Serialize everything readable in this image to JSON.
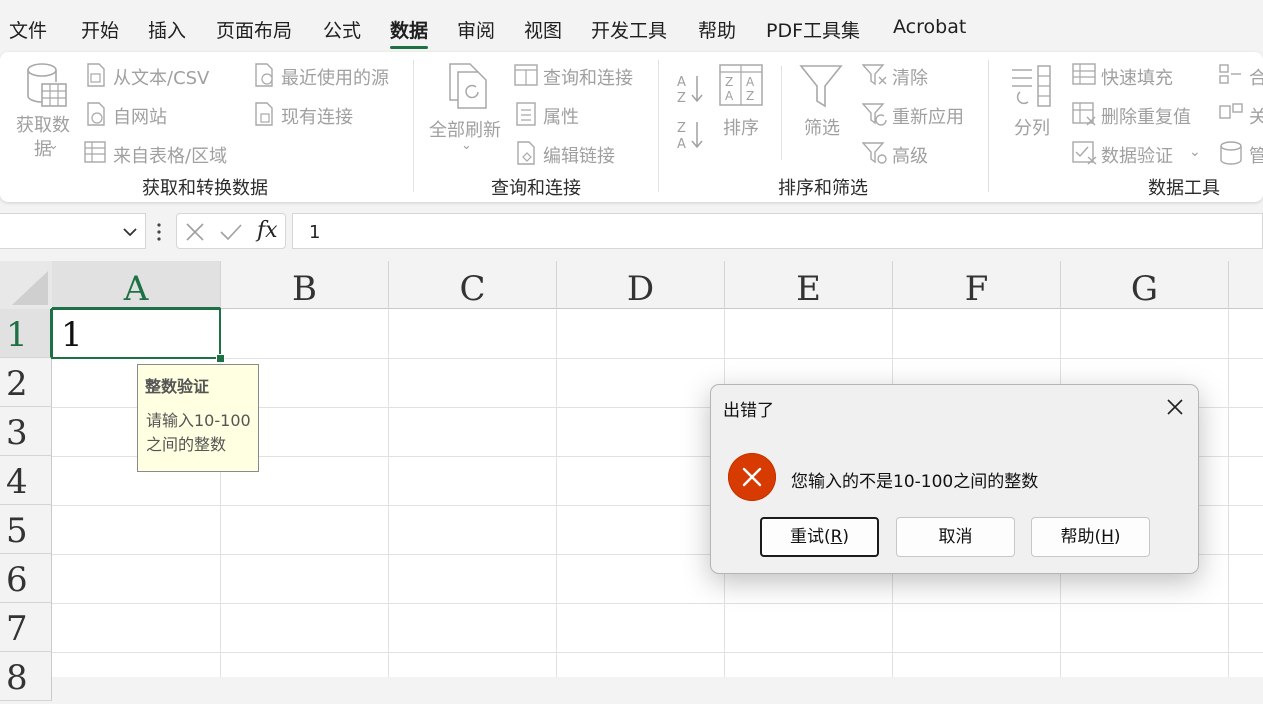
{
  "menu_tabs": [
    "文件",
    "开始",
    "插入",
    "页面布局",
    "公式",
    "数据",
    "审阅",
    "视图",
    "开发工具",
    "帮助",
    "PDF工具集",
    "Acrobat"
  ],
  "active_tab": "数据",
  "ribbon": {
    "get_data": "获取数\n据",
    "from_text_csv": "从文本/CSV",
    "from_web": "自网站",
    "from_table": "来自表格/区域",
    "recent_sources": "最近使用的源",
    "existing_connections": "现有连接",
    "group_get_transform": "获取和转换数据",
    "refresh_all": "全部刷新",
    "queries_connections": "查询和连接",
    "properties": "属性",
    "edit_links": "编辑链接",
    "group_queries": "查询和连接",
    "sort": "排序",
    "filter": "筛选",
    "clear": "清除",
    "reapply": "重新应用",
    "advanced": "高级",
    "group_sort_filter": "排序和筛选",
    "text_to_columns": "分列",
    "flash_fill": "快速填充",
    "remove_duplicates": "删除重复值",
    "data_validation": "数据验证",
    "merge_partial": "合",
    "relations_partial": "关",
    "manage_partial": "管",
    "group_data_tools": "数据工具"
  },
  "formula_bar": {
    "name_box": "",
    "formula": "1",
    "fx_label": "fx"
  },
  "columns": [
    "A",
    "B",
    "C",
    "D",
    "E",
    "F",
    "G"
  ],
  "rows": [
    "1",
    "2",
    "3",
    "4",
    "5",
    "6",
    "7",
    "8"
  ],
  "cells": {
    "A1": "1"
  },
  "input_message": {
    "title": "整数验证",
    "body": "请输入10-100之间的整数"
  },
  "dialog": {
    "title": "出错了",
    "message": "您输入的不是10-100之间的整数",
    "retry": "重试(",
    "retry_key": "R",
    "cancel": "取消",
    "help": "帮助(",
    "help_key": "H",
    "close_paren": ")"
  },
  "colors": {
    "accent": "#1e7145",
    "error": "#d83b01"
  }
}
